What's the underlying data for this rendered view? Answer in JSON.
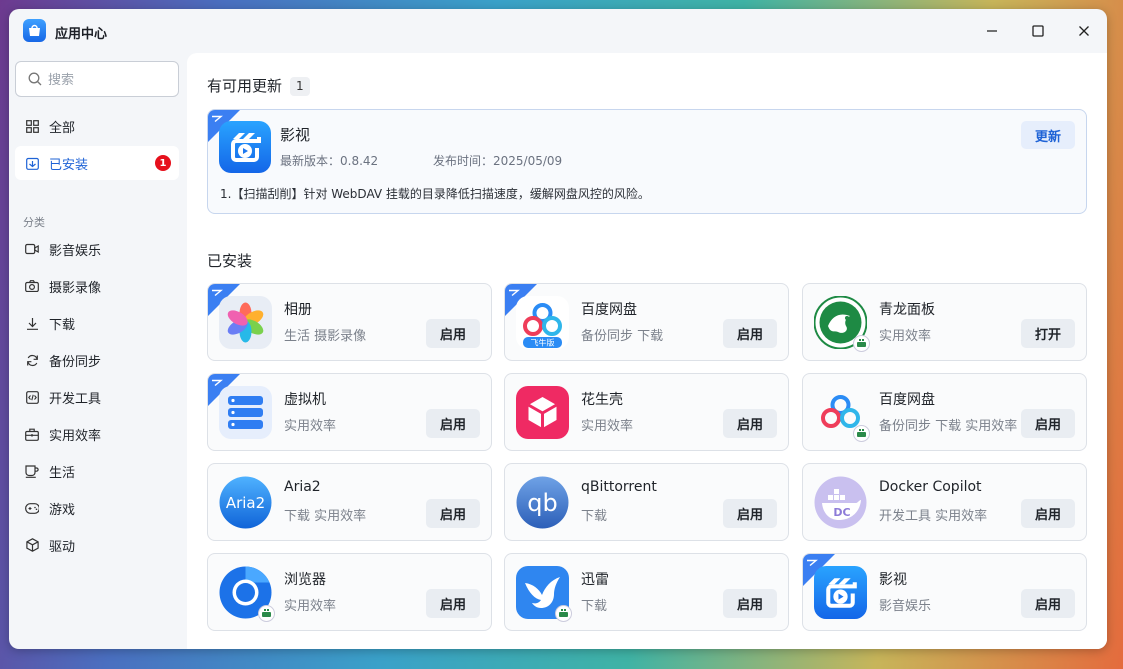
{
  "window": {
    "title": "应用中心"
  },
  "search": {
    "placeholder": "搜索"
  },
  "nav": {
    "all": "全部",
    "installed": "已安装",
    "installed_badge": "1"
  },
  "category": {
    "label": "分类",
    "items": [
      "影音娱乐",
      "摄影录像",
      "下载",
      "备份同步",
      "开发工具",
      "实用效率",
      "生活",
      "游戏",
      "驱动"
    ]
  },
  "updates": {
    "title": "有可用更新",
    "count": "1",
    "app": {
      "name": "影视",
      "version": "最新版本：0.8.42",
      "date": "发布时间：2025/05/09",
      "notes": "1.【扫描刮削】针对 WebDAV 挂载的目录降低扫描速度，缓解网盘风控的风险。",
      "button": "更新"
    }
  },
  "installed": {
    "title": "已安装",
    "apps": [
      {
        "name": "相册",
        "tags": "生活 摄影录像",
        "button": "启用",
        "icon": "photos-icon"
      },
      {
        "name": "百度网盘",
        "tags": "备份同步 下载",
        "button": "启用",
        "icon": "baidu-netdisk-icon",
        "sub": "飞牛版"
      },
      {
        "name": "青龙面板",
        "tags": "实用效率",
        "button": "打开",
        "icon": "qinglong-icon"
      },
      {
        "name": "虚拟机",
        "tags": "实用效率",
        "button": "启用",
        "icon": "vm-icon"
      },
      {
        "name": "花生壳",
        "tags": "实用效率",
        "button": "启用",
        "icon": "oray-icon"
      },
      {
        "name": "百度网盘",
        "tags": "备份同步 下载 实用效率",
        "button": "启用",
        "icon": "baidu-netdisk-icon"
      },
      {
        "name": "Aria2",
        "tags": "下载 实用效率",
        "button": "启用",
        "icon": "aria2-icon",
        "text": "Aria2"
      },
      {
        "name": "qBittorrent",
        "tags": "下载",
        "button": "启用",
        "icon": "qbittorrent-icon",
        "text": "qb"
      },
      {
        "name": "Docker Copilot",
        "tags": "开发工具 实用效率",
        "button": "启用",
        "icon": "docker-copilot-icon",
        "text": "DC"
      },
      {
        "name": "浏览器",
        "tags": "实用效率",
        "button": "启用",
        "icon": "browser-icon"
      },
      {
        "name": "迅雷",
        "tags": "下载",
        "button": "启用",
        "icon": "xunlei-icon"
      },
      {
        "name": "影视",
        "tags": "影音娱乐",
        "button": "启用",
        "icon": "video-icon"
      }
    ]
  }
}
